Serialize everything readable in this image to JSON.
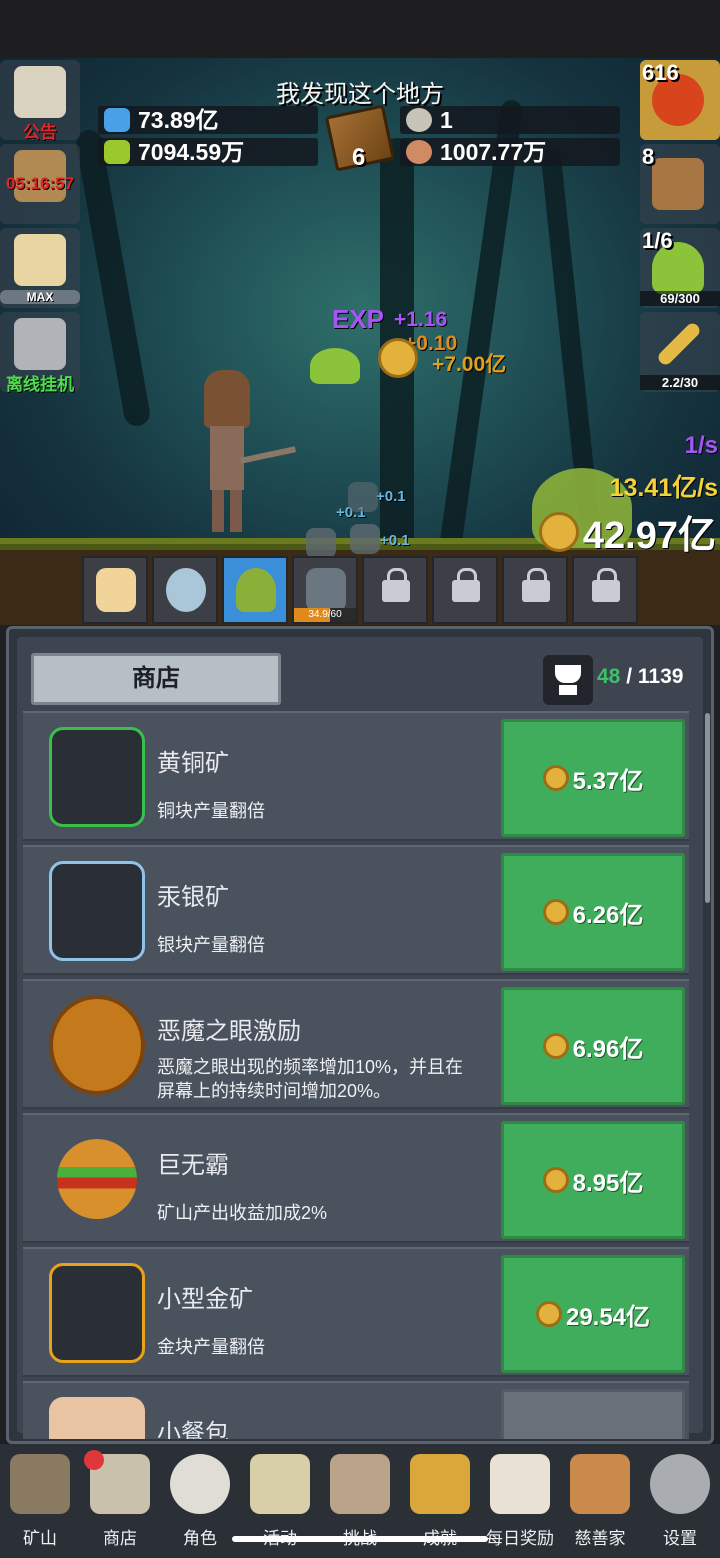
{
  "scene": {
    "title": "我发现这个地方",
    "resources": {
      "blue_potion": "73.89亿",
      "green_potion": "7094.59万",
      "book_count": "6",
      "silver": "1",
      "meat": "1007.77万"
    },
    "left_buttons": {
      "notice_label": "公告",
      "timer_label": "05:16:57",
      "max_label": "MAX",
      "offline_label": "离线挂机"
    },
    "right_buttons": {
      "potion_count": "616",
      "chest_count": "8",
      "slime_count": "1/6",
      "slime_progress": "69/300",
      "sword_progress": "2.2/30"
    },
    "floating": {
      "exp_label": "EXP",
      "exp_gain": "+1.16",
      "minor_gain": "+0.10",
      "gold_gain": "+7.00亿",
      "gain_a": "+0.1",
      "gain_b": "+0.1",
      "gain_c": "+0.1"
    },
    "rates": {
      "per_second": "1/s",
      "gold_per_second": "13.41亿/s",
      "gold_total": "42.97亿"
    },
    "slot_progress": "34.9/60",
    "slot_progress_fraction": 0.58
  },
  "shop": {
    "tab_label": "商店",
    "achievement_current": "48",
    "achievement_separator": " / ",
    "achievement_total": "1139",
    "items": [
      {
        "name": "黄铜矿",
        "desc": "铜块产量翻倍",
        "price": "5.37亿"
      },
      {
        "name": "汞银矿",
        "desc": "银块产量翻倍",
        "price": "6.26亿"
      },
      {
        "name": "恶魔之眼激励",
        "desc": "恶魔之眼出现的频率增加10%，并且在屏幕上的持续时间增加20%。",
        "price": "6.96亿"
      },
      {
        "name": "巨无霸",
        "desc": "矿山产出收益加成2%",
        "price": "8.95亿"
      },
      {
        "name": "小型金矿",
        "desc": "金块产量翻倍",
        "price": "29.54亿"
      },
      {
        "name": "小餐包",
        "desc": "",
        "price": ""
      }
    ]
  },
  "nav": {
    "items": [
      {
        "label": "矿山"
      },
      {
        "label": "商店"
      },
      {
        "label": "角色"
      },
      {
        "label": "活动"
      },
      {
        "label": "挑战"
      },
      {
        "label": "成就"
      },
      {
        "label": "每日奖励"
      },
      {
        "label": "慈善家"
      },
      {
        "label": "设置"
      }
    ]
  },
  "colors": {
    "buy_green": "#3fad5c",
    "exp_purple": "#a855f7",
    "gold_yellow": "#f5d23a",
    "notice_red": "#e02626",
    "offline_green": "#4be04b"
  }
}
